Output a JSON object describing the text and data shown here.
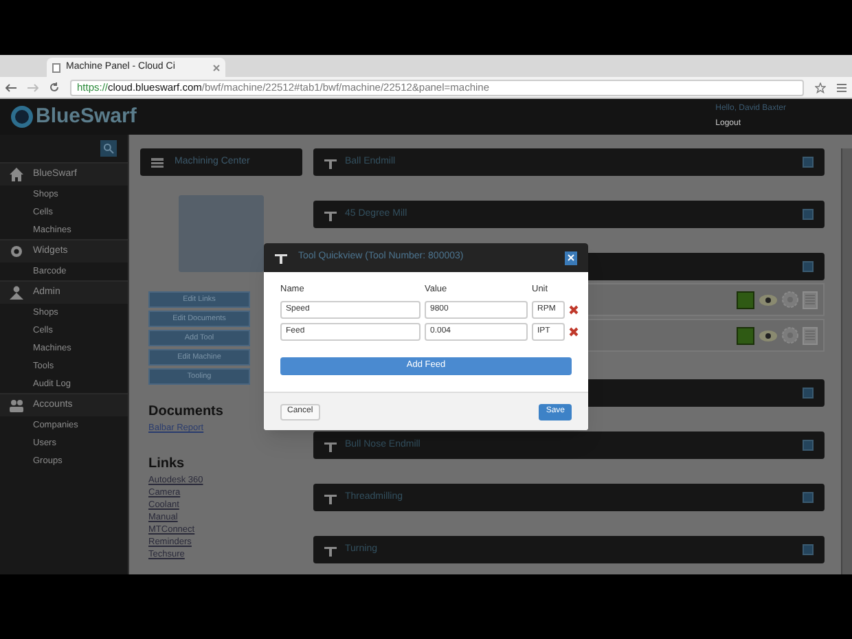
{
  "browser": {
    "tab_title": "Machine Panel - Cloud Ci",
    "url": "https://cloud.blueswarf.com/bwf/machine/22512#tab1/bwf/machine/22512&panel=machine"
  },
  "header": {
    "logo": "BlueSwarf",
    "greeting": "Hello, David Baxter",
    "logout": "Logout"
  },
  "sidebar": {
    "groups": [
      {
        "label": "BlueSwarf",
        "items": [
          "Shops",
          "Cells",
          "Machines"
        ]
      },
      {
        "label": "Widgets",
        "items": [
          "Barcode"
        ]
      },
      {
        "label": "Admin",
        "items": [
          "Shops",
          "Cells",
          "Machines",
          "Tools",
          "Audit Log"
        ]
      },
      {
        "label": "Accounts",
        "items": [
          "Companies",
          "Users",
          "Groups"
        ]
      }
    ]
  },
  "machine": {
    "title": "Machining Center",
    "buttons": [
      "Edit Links",
      "Edit Documents",
      "Add Tool",
      "Edit Machine",
      "Tooling"
    ],
    "documents_heading": "Documents",
    "documents": [
      "Balbar Report"
    ],
    "links_heading": "Links",
    "links": [
      "Autodesk 360",
      "Camera",
      "Coolant",
      "Manual",
      "MTConnect",
      "Reminders",
      "Techsure"
    ]
  },
  "tool_panels": [
    {
      "kind": "panel",
      "title": "Ball Endmill"
    },
    {
      "kind": "panel",
      "title": "45 Degree Mill"
    },
    {
      "kind": "panel"
    },
    {
      "kind": "rows",
      "rows": [
        {
          "kind": "tool"
        },
        {
          "kind": "tool"
        }
      ]
    },
    {
      "kind": "panel"
    },
    {
      "kind": "panel",
      "title": "Bull Nose Endmill"
    },
    {
      "kind": "panel",
      "title": "Threadmilling"
    },
    {
      "kind": "panel",
      "title": "Turning"
    }
  ],
  "modal": {
    "title": "Tool Quickview (Tool Number: 800003)",
    "columns": [
      "Name",
      "Value",
      "Unit"
    ],
    "fields": [
      {
        "name": "Speed",
        "value": "9800",
        "unit": "RPM"
      },
      {
        "name": "Feed",
        "value": "0.004",
        "unit": "IPT"
      }
    ],
    "add_button": "Add Feed",
    "cancel": "Cancel",
    "save": "Save"
  }
}
